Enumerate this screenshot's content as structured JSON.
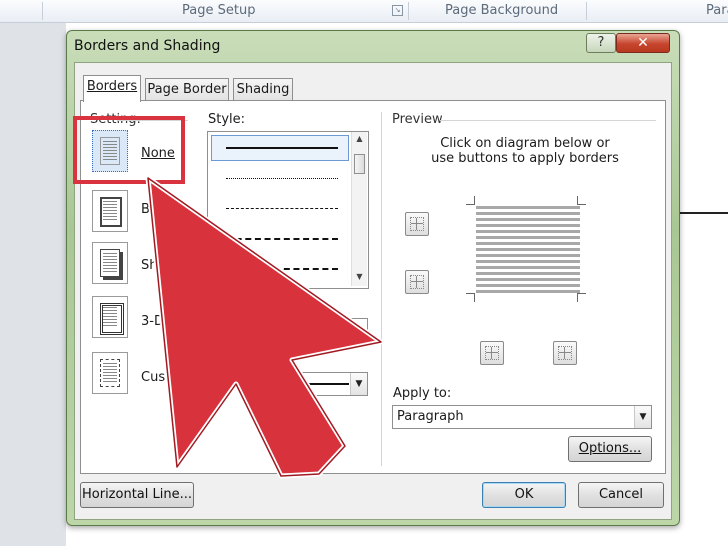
{
  "ribbon": {
    "groups": [
      "Page Setup",
      "Page Background",
      "Para"
    ]
  },
  "dialog": {
    "title": "Borders and Shading",
    "help_label": "?",
    "close_label": "✕",
    "tabs": [
      {
        "label": "Borders",
        "active": true
      },
      {
        "label": "Page Border",
        "active": false
      },
      {
        "label": "Shading",
        "active": false
      }
    ],
    "setting": {
      "group_label": "Setting:",
      "options": [
        {
          "label": "None",
          "selected": true
        },
        {
          "label": "Box",
          "selected": false
        },
        {
          "label": "Shadow",
          "selected": false
        },
        {
          "label": "3-D",
          "selected": false
        },
        {
          "label": "Custom",
          "selected": false
        }
      ]
    },
    "style": {
      "label": "Style:",
      "items": [
        "solid",
        "dotted",
        "dashed",
        "long-dash",
        "dash-dot"
      ]
    },
    "preview": {
      "label": "Preview",
      "instructions": "Click on diagram below or use buttons to apply borders"
    },
    "apply_to": {
      "label": "Apply to:",
      "value": "Paragraph"
    },
    "buttons": {
      "options": "Options...",
      "horizontal_line": "Horizontal Line...",
      "ok": "OK",
      "cancel": "Cancel"
    }
  },
  "annotation": {
    "highlight_color": "#d8333e",
    "arrow_fill": "#d8323c",
    "arrow_outline": "#ffffff"
  }
}
